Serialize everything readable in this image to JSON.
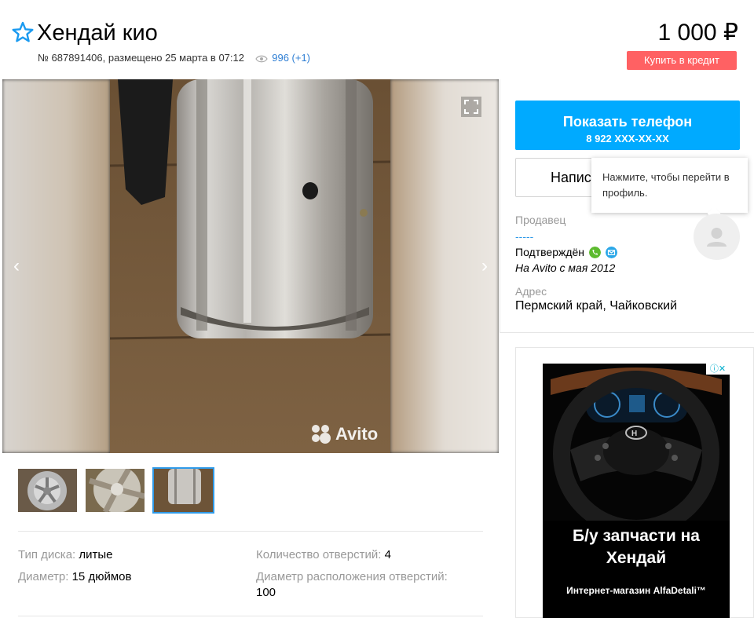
{
  "header": {
    "title": "Хендай кио",
    "ad_number": "№ 687891406, размещено 25 марта в 07:12",
    "views": "996 (+1)",
    "price": "1 000 ₽",
    "credit_label": "Купить в кредит"
  },
  "gallery": {
    "watermark": "Avito",
    "thumbnail_count": 3,
    "active_thumbnail": 3
  },
  "params": {
    "disk_type_key": "Тип диска:",
    "disk_type_value": "литые",
    "holes_key": "Количество отверстий:",
    "holes_value": "4",
    "diameter_key": "Диаметр:",
    "diameter_value": "15 дюймов",
    "pcd_key": "Диаметр расположения отверстий:",
    "pcd_value": "100"
  },
  "sidebar": {
    "phone_label": "Показать телефон",
    "phone_number": "8 922 XXX-XX-XX",
    "write_label": "Напис",
    "tooltip": "Нажмите, чтобы перейти в профиль.",
    "seller_label": "Продавец",
    "seller_name": "-----",
    "verified": "Подтверждён",
    "since": "На Avito с мая 2012",
    "address_label": "Адрес",
    "address_value": "Пермский край, Чайковский"
  },
  "ad": {
    "headline": "Б/у запчасти на Хендай",
    "sub": "Интернет-магазин AlfaDetali™",
    "info_icon": "ⓘ✕"
  },
  "colors": {
    "accent_blue": "#00aaff",
    "link_blue": "#2f9ae8",
    "credit_red": "#ff6163"
  }
}
